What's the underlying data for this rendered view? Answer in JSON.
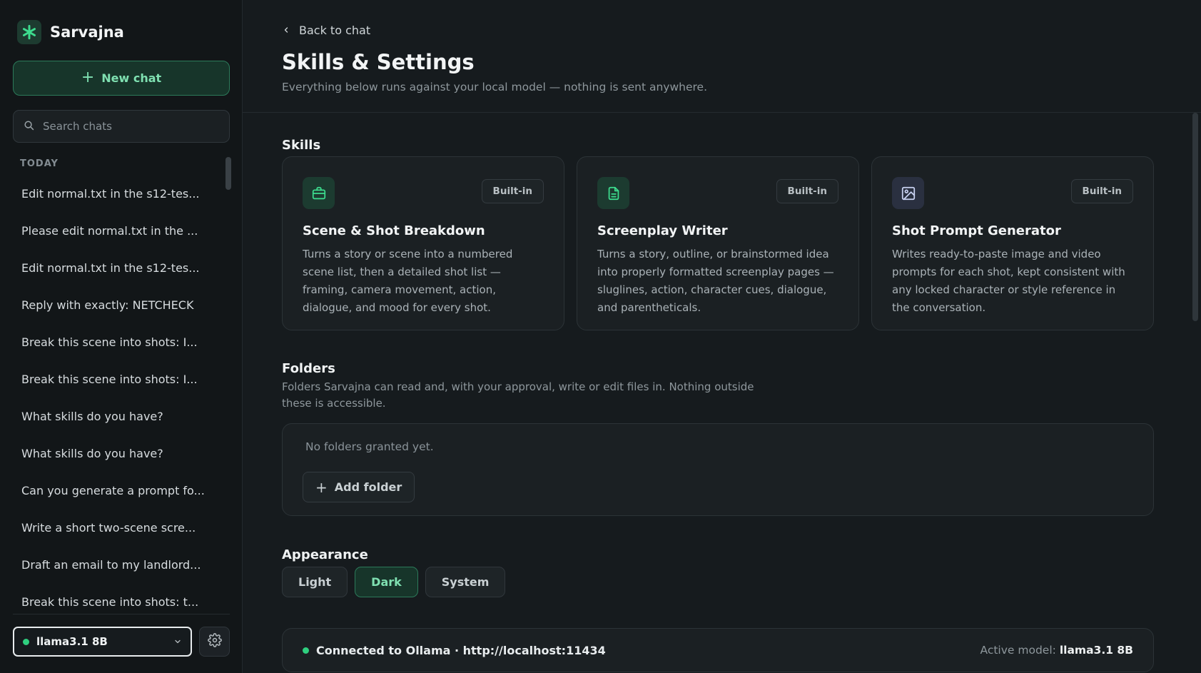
{
  "app": {
    "name": "Sarvajna",
    "new_chat_label": "New chat",
    "search_placeholder": "Search chats",
    "section_today": "TODAY"
  },
  "chats": [
    "Edit normal.txt in the s12-tes...",
    "Please edit normal.txt in the ...",
    "Edit normal.txt in the s12-tes...",
    "Reply with exactly: NETCHECK",
    "Break this scene into shots: I...",
    "Break this scene into shots: I...",
    "What skills do you have?",
    "What skills do you have?",
    "Can you generate a prompt fo...",
    "Write a short two-scene scre...",
    "Draft an email to my landlord...",
    "Break this scene into shots: t..."
  ],
  "footer": {
    "model_label": "llama3.1 8B"
  },
  "header": {
    "back_label": "Back to chat",
    "title": "Skills & Settings",
    "subtitle": "Everything below runs against your local model — nothing is sent anywhere."
  },
  "skills": {
    "heading": "Skills",
    "items": [
      {
        "badge": "Built-in",
        "title": "Scene & Shot Breakdown",
        "description": "Turns a story or scene into a numbered scene list, then a detailed shot list — framing, camera movement, action, dialogue, and mood for every shot.",
        "icon": "briefcase-icon"
      },
      {
        "badge": "Built-in",
        "title": "Screenplay Writer",
        "description": "Turns a story, outline, or brainstormed idea into properly formatted screenplay pages — sluglines, action, character cues, dialogue, and parentheticals.",
        "icon": "document-icon"
      },
      {
        "badge": "Built-in",
        "title": "Shot Prompt Generator",
        "description": "Writes ready-to-paste image and video prompts for each shot, kept consistent with any locked character or style reference in the conversation.",
        "icon": "image-icon"
      }
    ]
  },
  "folders": {
    "heading": "Folders",
    "description": "Folders Sarvajna can read and, with your approval, write or edit files in. Nothing outside these is accessible.",
    "empty_text": "No folders granted yet.",
    "add_label": "Add folder"
  },
  "appearance": {
    "heading": "Appearance",
    "options": [
      "Light",
      "Dark",
      "System"
    ],
    "selected": "Dark"
  },
  "status": {
    "connection": "Connected to Ollama · http://localhost:11434",
    "active_model_label": "Active model:",
    "active_model_value": "llama3.1 8B"
  },
  "colors": {
    "accent": "#2fcf7f",
    "background": "#161b1e",
    "sidebar": "#121618"
  }
}
